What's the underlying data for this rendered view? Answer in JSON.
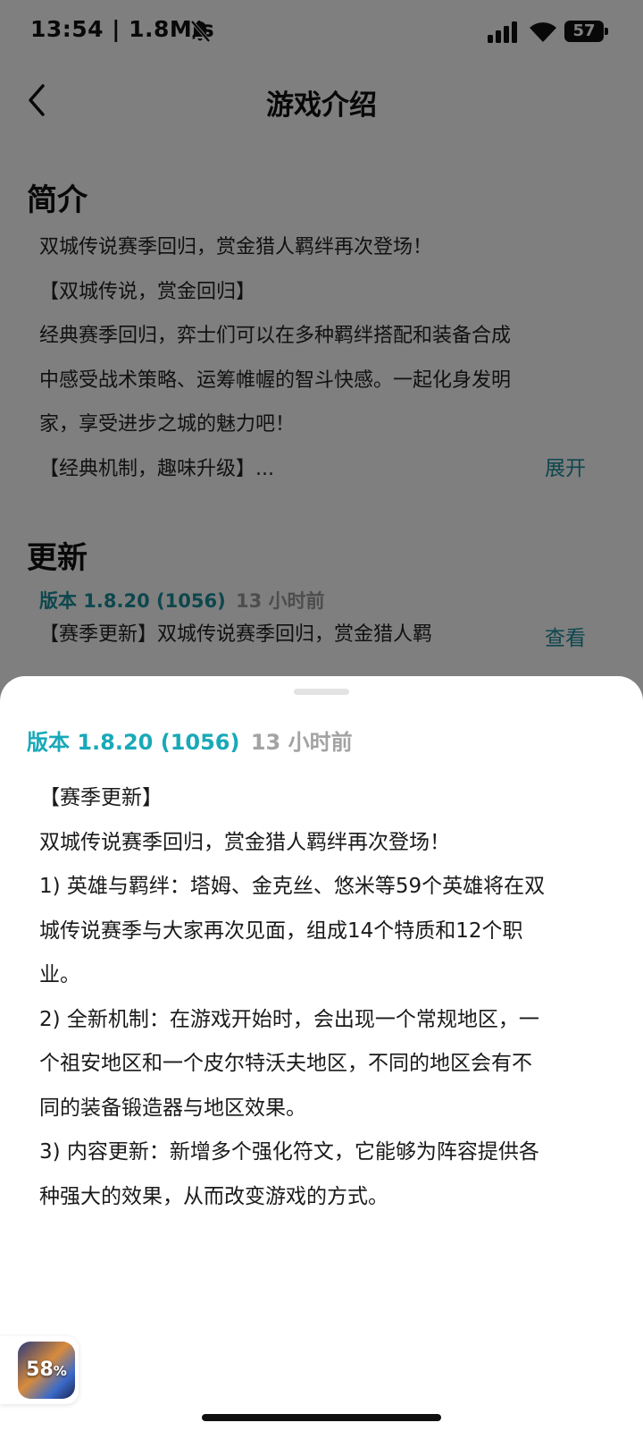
{
  "status_bar": {
    "time": "13:54 | 1.8M/s",
    "battery": "57"
  },
  "header": {
    "title": "游戏介绍"
  },
  "intro": {
    "heading": "简介",
    "lines": [
      "双城传说赛季回归，赏金猎人羁绊再次登场！",
      "【双城传说，赏金回归】",
      "经典赛季回归，弈士们可以在多种羁绊搭配和装备合成",
      "中感受战术策略、运筹帷幄的智斗快感。一起化身发明",
      "家，享受进步之城的魅力吧！",
      "【经典机制，趣味升级】..."
    ],
    "expand_label": "展开"
  },
  "update": {
    "heading": "更新",
    "version": "版本 1.8.20 (1056)",
    "time_ago": "13 小时前",
    "summary": "【赛季更新】双城传说赛季回归，赏金猎人羁",
    "view_label": "查看"
  },
  "sheet": {
    "version": "版本 1.8.20 (1056)",
    "time_ago": "13 小时前",
    "lines": [
      "【赛季更新】",
      "双城传说赛季回归，赏金猎人羁绊再次登场！",
      "1) 英雄与羁绊：塔姆、金克丝、悠米等59个英雄将在双",
      "城传说赛季与大家再次见面，组成14个特质和12个职",
      "业。",
      "2) 全新机制：在游戏开始时，会出现一个常规地区，一",
      "个祖安地区和一个皮尔特沃夫地区，不同的地区会有不",
      "同的装备锻造器与地区效果。",
      "3) 内容更新：新增多个强化符文，它能够为阵容提供各",
      "种强大的效果，从而改变游戏的方式。"
    ]
  },
  "floating_widget": {
    "progress_value": "58",
    "progress_unit": "%"
  },
  "colors": {
    "accent": "#1a8f9c",
    "accent_sheet": "#19a9b8",
    "muted": "#9a9a9a",
    "scrim": "rgba(0,0,0,0.5)"
  },
  "icons": [
    "bell-off-icon",
    "signal-icon",
    "wifi-icon",
    "battery-icon",
    "back-icon",
    "game-icon"
  ]
}
